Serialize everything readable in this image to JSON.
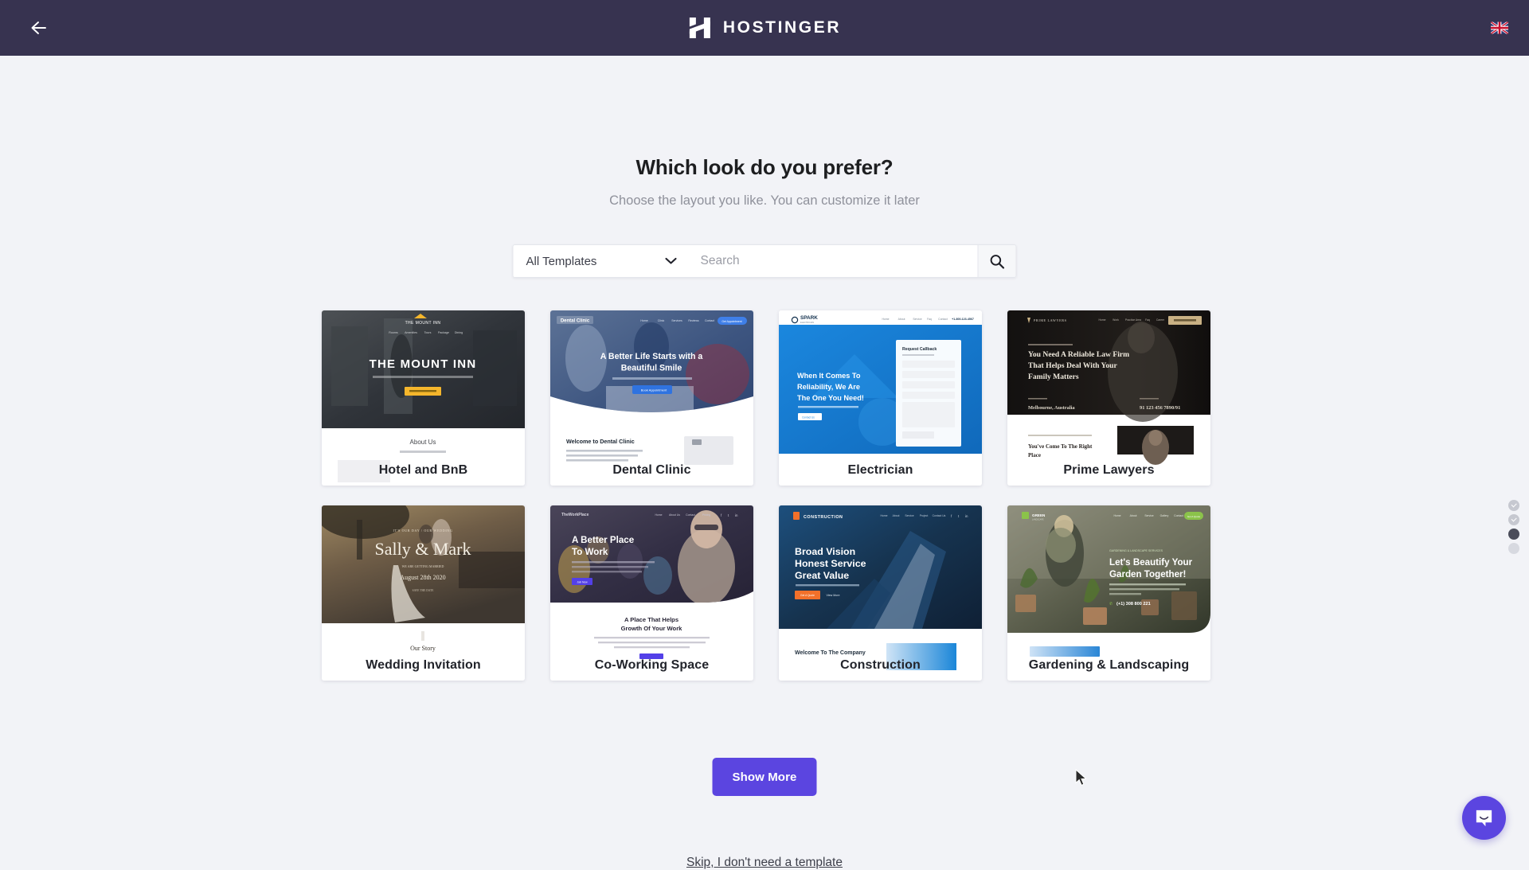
{
  "header": {
    "back_icon": "arrow-left-icon",
    "brand_mark": "hostinger-h-logo",
    "brand_name": "HOSTINGER",
    "language_flag": "uk-flag-icon",
    "bar_color": "#373350"
  },
  "main": {
    "title": "Which look do you prefer?",
    "subtitle": "Choose the layout you like. You can customize it later"
  },
  "search": {
    "category_selected": "All Templates",
    "dropdown_icon": "chevron-down-icon",
    "placeholder": "Search",
    "value": "",
    "search_icon": "search-icon"
  },
  "templates": [
    {
      "name": "Hotel and BnB",
      "hero_title": "THE MOUNT INN",
      "logo_text": "THE MOUNT INN",
      "section_title": "About Us",
      "cta": "BOOK YOUR STAY",
      "theme": "dark-hotel",
      "accent": "#f5b62c"
    },
    {
      "name": "Dental Clinic",
      "hero_title": "A Better Life Starts with a Beautiful Smile",
      "logo_text": "Dental Clinic",
      "section_title": "Welcome to Dental Clinic",
      "cta": "Book Appointment",
      "theme": "blue-dental",
      "accent": "#2f6fe4"
    },
    {
      "name": "Electrician",
      "hero_title": "When It Comes To Reliability, We Are The One You Need!",
      "logo_text": "SPARK",
      "section_title": "Request Callback",
      "cta": "Contact Us",
      "phone": "+1-800-123-4567",
      "theme": "bright-blue",
      "accent": "#1682d8"
    },
    {
      "name": "Prime Lawyers",
      "hero_title": "You Need A Reliable Law Firm That Helps Deal With Your Family Matters",
      "logo_text": "PRIME LAWYERS",
      "section_title": "You've Come To The Right Place",
      "location": "Melbourne, Australia",
      "phone": "91 123 456 7890/91",
      "theme": "dark-law",
      "accent": "#c9b184"
    },
    {
      "name": "Wedding Invitation",
      "hero_title": "Sally & Mark",
      "hero_date": "August 28th 2020",
      "section_title": "Our Story",
      "theme": "sepia-wedding",
      "accent": "#efe6d8"
    },
    {
      "name": "Co-Working Space",
      "hero_title": "A Better Place To Work",
      "logo_text": "TheWorkPlace",
      "section_title": "A Place That Helps Growth Of Your Work",
      "cta": "Join Now",
      "theme": "office-purple",
      "accent": "#5340e8"
    },
    {
      "name": "Construction",
      "hero_title": "Broad Vision Honest Service Great Value",
      "logo_text": "CONSTRUCTION",
      "section_title": "Welcome To The Company",
      "cta": "Get A Quote",
      "theme": "navy-construction",
      "accent": "#f2702a"
    },
    {
      "name": "Gardening & Landscaping",
      "hero_title": "Let's Beautify Your Garden Together!",
      "logo_text": "GREEN",
      "phone": "(+1) 308 800 221",
      "cta": "Get A Quote",
      "theme": "green-garden",
      "accent": "#8bc34a"
    }
  ],
  "actions": {
    "show_more": "Show More",
    "skip": "Skip, I don't need a template",
    "show_more_color": "#5b45e0"
  },
  "progress": {
    "steps": [
      {
        "state": "done",
        "icon": "check-icon"
      },
      {
        "state": "done",
        "icon": "check-icon"
      },
      {
        "state": "current",
        "icon": "filled-dot-icon"
      },
      {
        "state": "upcoming",
        "icon": "empty-dot-icon"
      }
    ]
  },
  "chat": {
    "icon": "chat-bubble-icon",
    "color": "#5b45e0"
  }
}
